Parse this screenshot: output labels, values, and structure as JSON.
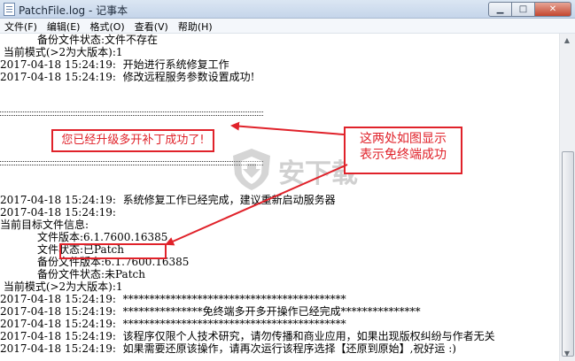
{
  "window": {
    "title": "PatchFile.log - 记事本",
    "minimize_glyph": "▁",
    "maximize_glyph": "□",
    "close_glyph": "✕"
  },
  "menu": [
    "文件(F)",
    "编辑(E)",
    "格式(O)",
    "查看(V)",
    "帮助(H)"
  ],
  "log_lines": [
    "           备份文件状态:文件不存在",
    " 当前模式(>2为大版本):1",
    "2017-04-18 15:24:19:  开始进行系统修复工作",
    "2017-04-18 15:24:19:  修改远程服务参数设置成功!",
    "",
    "",
    "",
    "",
    "",
    "",
    "",
    "",
    "2017-04-18 15:24:19:  系统修复工作已经完成，建议重新启动服务器",
    "2017-04-18 15:24:19:",
    "当前目标文件信息:",
    "           文件版本:6.1.7600.16385",
    "           文件状态:已Patch",
    "           备份文件版本:6.1.7600.16385",
    "           备份文件状态:未Patch",
    " 当前模式(>2为大版本):1",
    "2017-04-18 15:24:19:  ******************************************",
    "2017-04-18 15:24:19:  ***************免终端多开多开操作已经完成***************",
    "2017-04-18 15:24:19:  ******************************************",
    "2017-04-18 15:24:19:  该程序仅限个人技术研究，请勿传播和商业应用，如果出现版权纠纷与作者无关",
    "2017-04-18 15:24:19:  如果需要还原该操作，请再次运行该程序选择【还原到原始】,祝好运 :)"
  ],
  "annotations": {
    "upgrade_success": "您已经升级多开补丁成功了!",
    "note_line1": "这两处如图显示",
    "note_line2": "表示免终端成功",
    "color": "#e0222a"
  },
  "watermark": {
    "text": "安下载"
  },
  "scrollbar": {
    "up_glyph": "▲",
    "down_glyph": "▼"
  }
}
